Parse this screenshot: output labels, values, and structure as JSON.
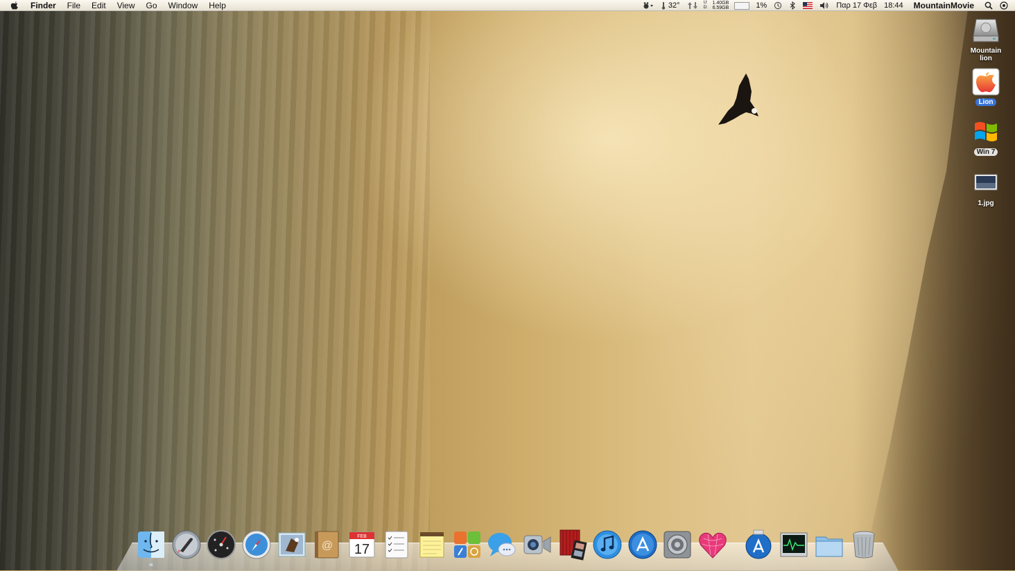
{
  "menubar": {
    "app_name": "Finder",
    "menus": [
      "File",
      "Edit",
      "View",
      "Go",
      "Window",
      "Help"
    ],
    "status": {
      "temperature": "32°",
      "memory_used": "1.40GB",
      "memory_free": "6.59GB",
      "net_up_label": "U:",
      "net_down_label": "D:",
      "cpu_percent": "1%",
      "date": "Παρ 17 Φεβ",
      "time": "18:44",
      "user": "MountainMovie"
    }
  },
  "desktop_icons": [
    {
      "label": "Mountain lion",
      "icon": "hard-drive-icon"
    },
    {
      "label": "Lion",
      "icon": "apple-drive-icon",
      "selected": true
    },
    {
      "label": "Win 7",
      "icon": "windows-drive-icon"
    },
    {
      "label": "1.jpg",
      "icon": "image-file-icon"
    }
  ],
  "dock": {
    "apps": [
      "finder-icon",
      "launchpad-icon",
      "dashboard-icon",
      "safari-icon",
      "mail-icon",
      "address-book-icon",
      "calendar-icon",
      "reminders-icon",
      "notes-icon",
      "grid-app-icon",
      "messages-icon",
      "facetime-icon",
      "photo-booth-icon",
      "itunes-icon",
      "app-store-icon",
      "system-preferences-icon",
      "heart-app-icon"
    ],
    "calendar_day": "17",
    "calendar_month": "FEB",
    "stack": [
      "applications-stack-icon",
      "activity-monitor-icon",
      "documents-folder-icon",
      "trash-icon"
    ]
  },
  "colors": {
    "selection_blue": "#3874d8",
    "menubar_bg": "#f4f0e6"
  }
}
